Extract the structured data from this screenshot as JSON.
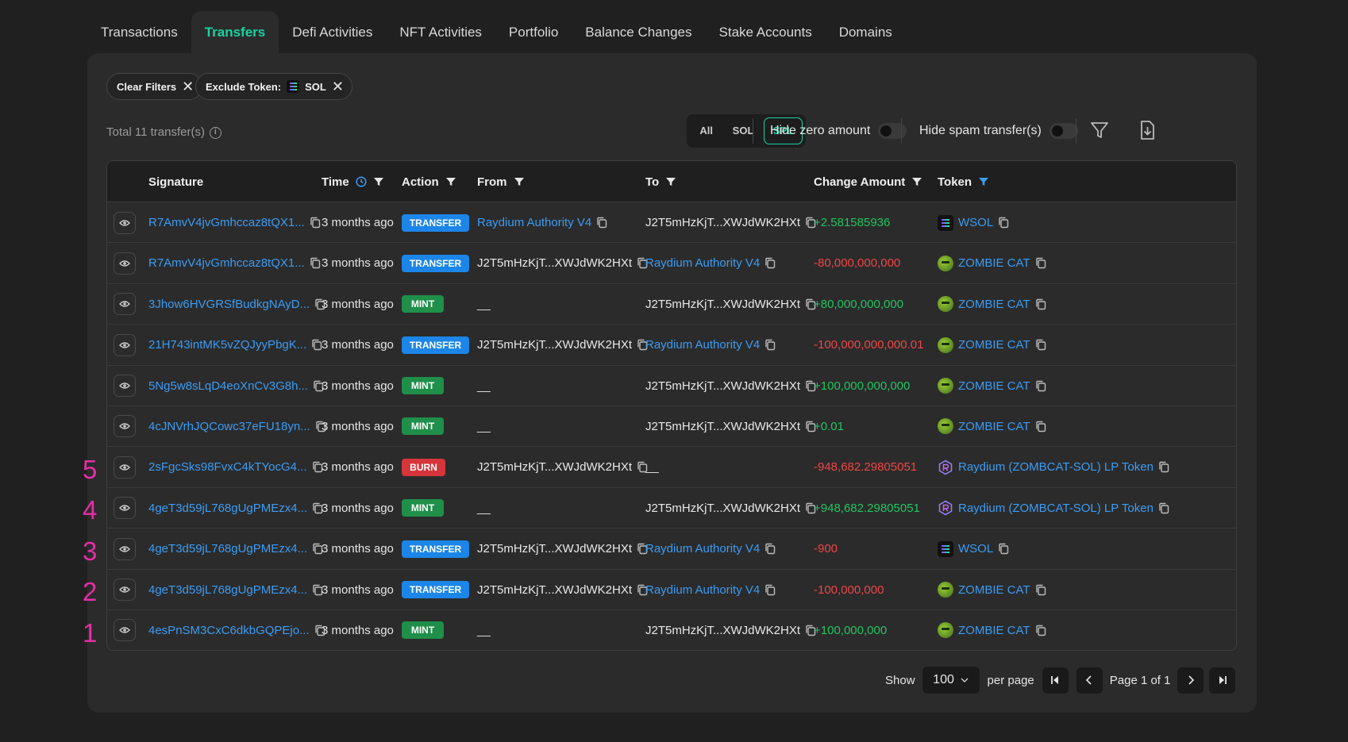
{
  "tabs": [
    "Transactions",
    "Transfers",
    "Defi Activities",
    "NFT Activities",
    "Portfolio",
    "Balance Changes",
    "Stake Accounts",
    "Domains"
  ],
  "active_tab": "Transfers",
  "filters": {
    "clear_label": "Clear Filters",
    "exclude_label": "Exclude Token:",
    "exclude_token": "SOL"
  },
  "summary": {
    "total_text": "Total 11 transfer(s)"
  },
  "segment": {
    "all": "All",
    "sol": "SOL",
    "spl": "SPL",
    "selected": "SPL"
  },
  "toggles": {
    "hide_zero": "Hide zero amount",
    "hide_spam": "Hide spam transfer(s)"
  },
  "table": {
    "headers": {
      "signature": "Signature",
      "time": "Time",
      "action": "Action",
      "from": "From",
      "to": "To",
      "change": "Change Amount",
      "token": "Token"
    },
    "rows": [
      {
        "sig": "R7AmvV4jvGmhccaz8tQX1...",
        "time": "3 months ago",
        "action": "TRANSFER",
        "from": "Raydium Authority V4",
        "from_link": true,
        "to": "J2T5mHzKjT...XWJdWK2HXt",
        "to_link": false,
        "amount": "+2.581585936",
        "token": "WSOL",
        "token_icon": "wsol-icon"
      },
      {
        "sig": "R7AmvV4jvGmhccaz8tQX1...",
        "time": "3 months ago",
        "action": "TRANSFER",
        "from": "J2T5mHzKjT...XWJdWK2HXt",
        "from_link": false,
        "to": "Raydium Authority V4",
        "to_link": true,
        "amount": "-80,000,000,000",
        "token": "ZOMBIE CAT",
        "token_icon": "zombie-cat-icon"
      },
      {
        "sig": "3Jhow6HVGRSfBudkgNAyD...",
        "time": "3 months ago",
        "action": "MINT",
        "from": "__",
        "from_link": false,
        "to": "J2T5mHzKjT...XWJdWK2HXt",
        "to_link": false,
        "amount": "+80,000,000,000",
        "token": "ZOMBIE CAT",
        "token_icon": "zombie-cat-icon"
      },
      {
        "sig": "21H743intMK5vZQJyyPbgK...",
        "time": "3 months ago",
        "action": "TRANSFER",
        "from": "J2T5mHzKjT...XWJdWK2HXt",
        "from_link": false,
        "to": "Raydium Authority V4",
        "to_link": true,
        "amount": "-100,000,000,000.01",
        "token": "ZOMBIE CAT",
        "token_icon": "zombie-cat-icon"
      },
      {
        "sig": "5Ng5w8sLqD4eoXnCv3G8h...",
        "time": "3 months ago",
        "action": "MINT",
        "from": "__",
        "from_link": false,
        "to": "J2T5mHzKjT...XWJdWK2HXt",
        "to_link": false,
        "amount": "+100,000,000,000",
        "token": "ZOMBIE CAT",
        "token_icon": "zombie-cat-icon"
      },
      {
        "sig": "4cJNVrhJQCowc37eFU18yn...",
        "time": "3 months ago",
        "action": "MINT",
        "from": "__",
        "from_link": false,
        "to": "J2T5mHzKjT...XWJdWK2HXt",
        "to_link": false,
        "amount": "+0.01",
        "token": "ZOMBIE CAT",
        "token_icon": "zombie-cat-icon"
      },
      {
        "sig": "2sFgcSks98FvxC4kTYocG4...",
        "time": "3 months ago",
        "action": "BURN",
        "from": "J2T5mHzKjT...XWJdWK2HXt",
        "from_link": false,
        "to": "__",
        "to_link": false,
        "amount": "-948,682.29805051",
        "token": "Raydium (ZOMBCAT-SOL) LP Token",
        "token_icon": "raydium-icon"
      },
      {
        "sig": "4geT3d59jL768gUgPMEzx4...",
        "time": "3 months ago",
        "action": "MINT",
        "from": "__",
        "from_link": false,
        "to": "J2T5mHzKjT...XWJdWK2HXt",
        "to_link": false,
        "amount": "+948,682.29805051",
        "token": "Raydium (ZOMBCAT-SOL) LP Token",
        "token_icon": "raydium-icon"
      },
      {
        "sig": "4geT3d59jL768gUgPMEzx4...",
        "time": "3 months ago",
        "action": "TRANSFER",
        "from": "J2T5mHzKjT...XWJdWK2HXt",
        "from_link": false,
        "to": "Raydium Authority V4",
        "to_link": true,
        "amount": "-900",
        "token": "WSOL",
        "token_icon": "wsol-icon"
      },
      {
        "sig": "4geT3d59jL768gUgPMEzx4...",
        "time": "3 months ago",
        "action": "TRANSFER",
        "from": "J2T5mHzKjT...XWJdWK2HXt",
        "from_link": false,
        "to": "Raydium Authority V4",
        "to_link": true,
        "amount": "-100,000,000",
        "token": "ZOMBIE CAT",
        "token_icon": "zombie-cat-icon"
      },
      {
        "sig": "4esPnSM3CxC6dkbGQPEjo...",
        "time": "3 months ago",
        "action": "MINT",
        "from": "__",
        "from_link": false,
        "to": "J2T5mHzKjT...XWJdWK2HXt",
        "to_link": false,
        "amount": "+100,000,000",
        "token": "ZOMBIE CAT",
        "token_icon": "zombie-cat-icon"
      }
    ]
  },
  "annotations": [
    "5",
    "4",
    "3",
    "2",
    "1"
  ],
  "pagination": {
    "show_label": "Show",
    "page_size": "100",
    "per_page_label": "per page",
    "page_text": "Page 1 of 1"
  },
  "colors": {
    "accent": "#19d3a2",
    "link": "#3b9cf5",
    "positive": "#22c55e",
    "negative": "#f04545",
    "transfer": "#1c86e8",
    "mint": "#1f8f49",
    "burn": "#d6363b",
    "annotation": "#e62ea6"
  }
}
